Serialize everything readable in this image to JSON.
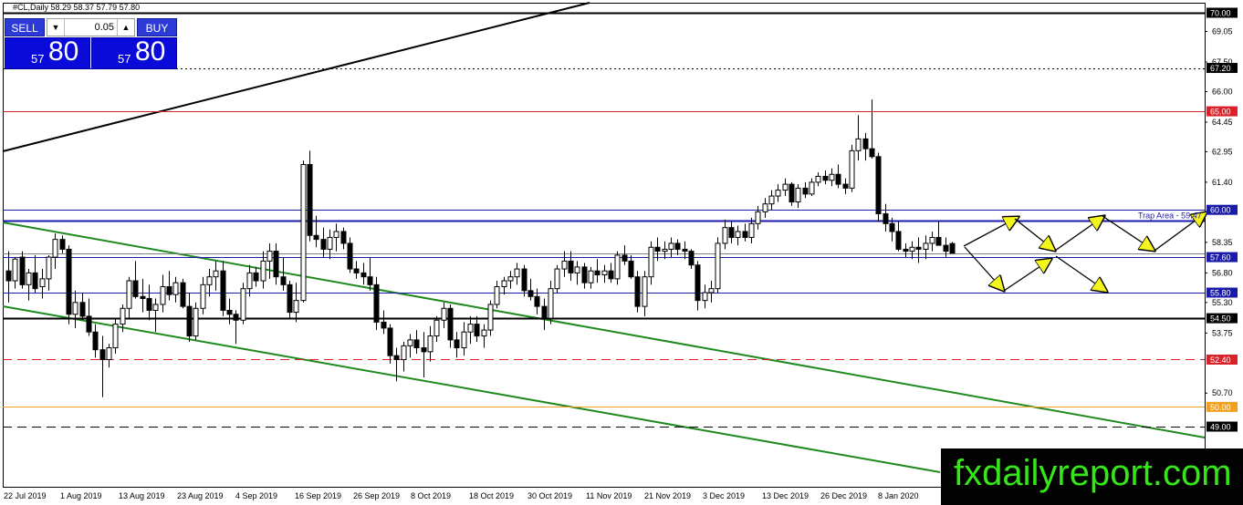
{
  "chart_header": {
    "symbol_line": "#CL,Daily  58.29 58.37 57.79 57.80"
  },
  "trade_panel": {
    "sell_label": "SELL",
    "buy_label": "BUY",
    "lot_value": "0.05",
    "down_arrow": "▼",
    "up_arrow": "▲",
    "sell_price_small": "57",
    "sell_price_big": "80",
    "buy_price_small": "57",
    "buy_price_big": "80"
  },
  "price_axis": {
    "ticks": [
      "69.05",
      "67.50",
      "66.00",
      "64.45",
      "62.95",
      "61.40",
      "58.35",
      "56.80",
      "55.30",
      "53.75",
      "50.70"
    ]
  },
  "date_axis": {
    "labels": [
      "22 Jul 2019",
      "1 Aug 2019",
      "13 Aug 2019",
      "23 Aug 2019",
      "4 Sep 2019",
      "16 Sep 2019",
      "26 Sep 2019",
      "8 Oct 2019",
      "18 Oct 2019",
      "30 Oct 2019",
      "11 Nov 2019",
      "21 Nov 2019",
      "3 Dec 2019",
      "13 Dec 2019",
      "26 Dec 2019",
      "8 Jan 2020"
    ]
  },
  "levels": [
    {
      "label": "70.00",
      "price": 70.0,
      "color": "#000000",
      "style": "solid-bold"
    },
    {
      "label": "67.20",
      "price": 67.2,
      "color": "#000000",
      "style": "dotted"
    },
    {
      "label": "65.00",
      "price": 65.0,
      "color": "#d8232a",
      "style": "solid"
    },
    {
      "label": "60.00",
      "price": 60.0,
      "color": "#1a1aa8",
      "style": "solid"
    },
    {
      "label": "57.60",
      "price": 57.6,
      "color": "#1a1aa8",
      "style": "solid"
    },
    {
      "label": "55.80",
      "price": 55.8,
      "color": "#1a1aa8",
      "style": "solid"
    },
    {
      "label": "54.50",
      "price": 54.5,
      "color": "#000000",
      "style": "solid-bold"
    },
    {
      "label": "52.40",
      "price": 52.4,
      "color": "#d8232a",
      "style": "dashed"
    },
    {
      "label": "50.00",
      "price": 50.0,
      "color": "#f0a020",
      "style": "solid"
    },
    {
      "label": "49.00",
      "price": 49.0,
      "color": "#000000",
      "style": "dashed"
    }
  ],
  "trap_area": {
    "label": "Trap Area - 59.47",
    "price": 59.47,
    "color": "#1a1aa8"
  },
  "current_price": {
    "price": 57.8,
    "color": "#808080"
  },
  "colors": {
    "bull": "#ffffff",
    "bear": "#000000",
    "channel": "#1e8a1e",
    "arrow_fill": "#f5f51e",
    "tag_text_white": "#ffffff"
  },
  "watermark": {
    "text": "fxdailyreport.com"
  },
  "chart_data": {
    "type": "candlestick",
    "ylim": [
      47.0,
      70.6
    ],
    "candles": [
      [
        56.9,
        57.9,
        55.3,
        56.4
      ],
      [
        56.4,
        57.6,
        56.0,
        57.5
      ],
      [
        57.6,
        57.9,
        56.0,
        56.2
      ],
      [
        56.2,
        57.0,
        55.4,
        56.8
      ],
      [
        56.8,
        57.7,
        55.8,
        56.0
      ],
      [
        56.1,
        57.0,
        55.5,
        56.5
      ],
      [
        56.5,
        57.7,
        55.9,
        57.6
      ],
      [
        57.6,
        58.8,
        57.0,
        58.5
      ],
      [
        58.5,
        58.7,
        57.8,
        58.0
      ],
      [
        58.0,
        58.2,
        54.2,
        54.7
      ],
      [
        54.7,
        55.9,
        54.0,
        55.3
      ],
      [
        55.3,
        55.8,
        54.4,
        54.6
      ],
      [
        54.6,
        55.5,
        53.6,
        53.8
      ],
      [
        53.8,
        54.2,
        52.5,
        52.9
      ],
      [
        52.9,
        53.6,
        50.5,
        52.4
      ],
      [
        52.4,
        53.2,
        52.0,
        53.0
      ],
      [
        53.0,
        54.5,
        52.7,
        54.2
      ],
      [
        54.2,
        55.2,
        53.8,
        55.0
      ],
      [
        55.0,
        56.6,
        54.5,
        56.4
      ],
      [
        56.4,
        57.4,
        55.5,
        55.6
      ],
      [
        55.6,
        56.5,
        54.8,
        55.5
      ],
      [
        55.5,
        56.2,
        54.4,
        54.9
      ],
      [
        54.9,
        55.5,
        53.8,
        55.2
      ],
      [
        55.2,
        56.7,
        54.8,
        56.1
      ],
      [
        56.1,
        56.9,
        55.4,
        55.7
      ],
      [
        55.7,
        56.6,
        55.3,
        56.3
      ],
      [
        56.3,
        56.5,
        55.0,
        55.1
      ],
      [
        55.1,
        55.8,
        53.3,
        53.6
      ],
      [
        53.6,
        55.3,
        53.4,
        55.0
      ],
      [
        55.0,
        56.6,
        54.7,
        56.2
      ],
      [
        56.2,
        57.0,
        55.6,
        56.6
      ],
      [
        56.6,
        57.4,
        55.9,
        56.9
      ],
      [
        56.9,
        57.4,
        54.6,
        54.9
      ],
      [
        54.9,
        55.5,
        54.2,
        54.7
      ],
      [
        54.7,
        54.9,
        53.2,
        54.4
      ],
      [
        54.4,
        56.3,
        54.2,
        56.0
      ],
      [
        56.0,
        57.2,
        55.6,
        56.8
      ],
      [
        56.8,
        57.1,
        56.1,
        56.4
      ],
      [
        56.4,
        57.9,
        56.0,
        57.4
      ],
      [
        57.4,
        58.3,
        56.5,
        57.9
      ],
      [
        57.9,
        58.3,
        56.2,
        56.6
      ],
      [
        56.6,
        57.6,
        55.9,
        56.2
      ],
      [
        56.2,
        56.4,
        54.5,
        54.8
      ],
      [
        54.8,
        56.3,
        54.3,
        55.4
      ],
      [
        55.4,
        62.5,
        55.3,
        62.3
      ],
      [
        62.3,
        63.0,
        58.4,
        58.7
      ],
      [
        58.7,
        59.7,
        58.1,
        58.5
      ],
      [
        58.5,
        59.1,
        57.6,
        58.0
      ],
      [
        58.0,
        59.0,
        57.5,
        58.6
      ],
      [
        58.6,
        59.3,
        57.9,
        58.9
      ],
      [
        58.9,
        59.1,
        58.0,
        58.3
      ],
      [
        58.3,
        58.6,
        56.8,
        57.0
      ],
      [
        57.0,
        57.4,
        56.5,
        56.8
      ],
      [
        56.8,
        57.3,
        56.2,
        56.6
      ],
      [
        56.6,
        57.6,
        55.9,
        56.2
      ],
      [
        56.2,
        56.6,
        53.9,
        54.3
      ],
      [
        54.3,
        54.9,
        53.7,
        54.0
      ],
      [
        54.0,
        54.2,
        52.2,
        52.6
      ],
      [
        52.6,
        53.0,
        51.3,
        52.4
      ],
      [
        52.4,
        53.3,
        51.8,
        53.1
      ],
      [
        53.1,
        53.7,
        52.5,
        53.4
      ],
      [
        53.4,
        53.9,
        52.7,
        53.0
      ],
      [
        53.0,
        53.8,
        51.5,
        52.8
      ],
      [
        52.8,
        54.1,
        52.3,
        53.6
      ],
      [
        53.6,
        54.6,
        53.3,
        54.4
      ],
      [
        54.4,
        55.3,
        54.0,
        55.0
      ],
      [
        55.0,
        55.2,
        53.0,
        53.4
      ],
      [
        53.4,
        53.8,
        52.5,
        53.0
      ],
      [
        53.0,
        54.3,
        52.6,
        53.8
      ],
      [
        53.8,
        54.6,
        53.2,
        54.2
      ],
      [
        54.2,
        54.6,
        53.3,
        53.6
      ],
      [
        53.6,
        54.2,
        53.0,
        53.9
      ],
      [
        53.9,
        55.4,
        53.6,
        55.2
      ],
      [
        55.2,
        56.4,
        55.0,
        56.1
      ],
      [
        56.1,
        56.6,
        55.7,
        56.4
      ],
      [
        56.4,
        56.9,
        56.0,
        56.6
      ],
      [
        56.6,
        57.3,
        56.2,
        57.0
      ],
      [
        57.0,
        57.2,
        55.6,
        55.9
      ],
      [
        55.9,
        56.5,
        55.4,
        55.6
      ],
      [
        55.6,
        56.0,
        54.7,
        55.1
      ],
      [
        55.1,
        55.5,
        53.9,
        54.5
      ],
      [
        54.5,
        56.4,
        54.2,
        56.0
      ],
      [
        56.0,
        57.2,
        55.8,
        57.0
      ],
      [
        57.0,
        57.9,
        56.6,
        57.4
      ],
      [
        57.4,
        57.9,
        56.4,
        56.8
      ],
      [
        56.8,
        57.4,
        56.2,
        57.1
      ],
      [
        57.1,
        57.3,
        56.0,
        56.3
      ],
      [
        56.3,
        57.1,
        56.0,
        56.9
      ],
      [
        56.9,
        57.5,
        56.3,
        56.7
      ],
      [
        56.7,
        57.2,
        56.3,
        56.9
      ],
      [
        56.9,
        57.3,
        56.3,
        56.5
      ],
      [
        56.5,
        57.9,
        56.2,
        57.7
      ],
      [
        57.7,
        58.2,
        57.2,
        57.4
      ],
      [
        57.4,
        57.7,
        56.5,
        56.6
      ],
      [
        56.6,
        56.9,
        54.8,
        55.1
      ],
      [
        55.1,
        56.9,
        54.6,
        56.6
      ],
      [
        56.6,
        58.4,
        56.2,
        58.1
      ],
      [
        58.1,
        58.6,
        57.4,
        57.9
      ],
      [
        57.9,
        58.4,
        57.5,
        58.0
      ],
      [
        58.0,
        58.6,
        57.6,
        58.3
      ],
      [
        58.3,
        58.5,
        57.7,
        58.0
      ],
      [
        58.0,
        58.4,
        57.5,
        57.9
      ],
      [
        57.9,
        58.0,
        57.0,
        57.2
      ],
      [
        57.2,
        57.4,
        54.9,
        55.4
      ],
      [
        55.4,
        56.2,
        55.0,
        55.8
      ],
      [
        55.8,
        56.4,
        55.3,
        56.0
      ],
      [
        56.0,
        58.6,
        55.8,
        58.3
      ],
      [
        58.3,
        59.5,
        58.0,
        59.1
      ],
      [
        59.1,
        59.4,
        58.3,
        58.6
      ],
      [
        58.6,
        59.2,
        58.2,
        58.9
      ],
      [
        58.9,
        59.3,
        58.4,
        58.6
      ],
      [
        58.6,
        59.6,
        58.3,
        59.3
      ],
      [
        59.3,
        60.2,
        59.0,
        59.9
      ],
      [
        59.9,
        60.6,
        59.6,
        60.3
      ],
      [
        60.3,
        61.0,
        60.0,
        60.7
      ],
      [
        60.7,
        61.3,
        60.4,
        61.0
      ],
      [
        61.0,
        61.6,
        60.7,
        61.3
      ],
      [
        61.3,
        61.4,
        60.2,
        60.4
      ],
      [
        60.4,
        61.3,
        60.1,
        61.1
      ],
      [
        61.1,
        61.4,
        60.6,
        60.8
      ],
      [
        60.8,
        61.6,
        60.7,
        61.4
      ],
      [
        61.4,
        61.9,
        61.2,
        61.7
      ],
      [
        61.7,
        62.0,
        61.3,
        61.5
      ],
      [
        61.5,
        62.1,
        61.2,
        61.8
      ],
      [
        61.8,
        62.3,
        61.1,
        61.3
      ],
      [
        61.3,
        61.6,
        60.8,
        61.1
      ],
      [
        61.1,
        63.3,
        60.9,
        63.0
      ],
      [
        63.0,
        64.8,
        62.5,
        63.6
      ],
      [
        63.6,
        63.9,
        62.5,
        63.1
      ],
      [
        63.1,
        65.6,
        62.6,
        62.7
      ],
      [
        62.7,
        62.9,
        59.4,
        59.8
      ],
      [
        59.8,
        60.3,
        58.9,
        59.3
      ],
      [
        59.3,
        59.6,
        58.4,
        58.9
      ],
      [
        58.9,
        59.4,
        57.9,
        58.0
      ],
      [
        58.0,
        58.3,
        57.6,
        57.9
      ],
      [
        57.9,
        58.4,
        57.5,
        58.1
      ],
      [
        58.1,
        58.6,
        57.3,
        58.0
      ],
      [
        58.0,
        58.7,
        57.5,
        58.3
      ],
      [
        58.3,
        58.9,
        57.9,
        58.6
      ],
      [
        58.6,
        59.4,
        58.2,
        58.2
      ],
      [
        58.2,
        58.6,
        57.6,
        57.9
      ],
      [
        58.29,
        58.37,
        57.79,
        57.8
      ]
    ],
    "annotations": {
      "trendline": {
        "color": "#000000"
      },
      "channel": {
        "color": "#1e8a1e"
      },
      "scenario_arrows": {
        "fill": "#f5f51e"
      }
    }
  }
}
